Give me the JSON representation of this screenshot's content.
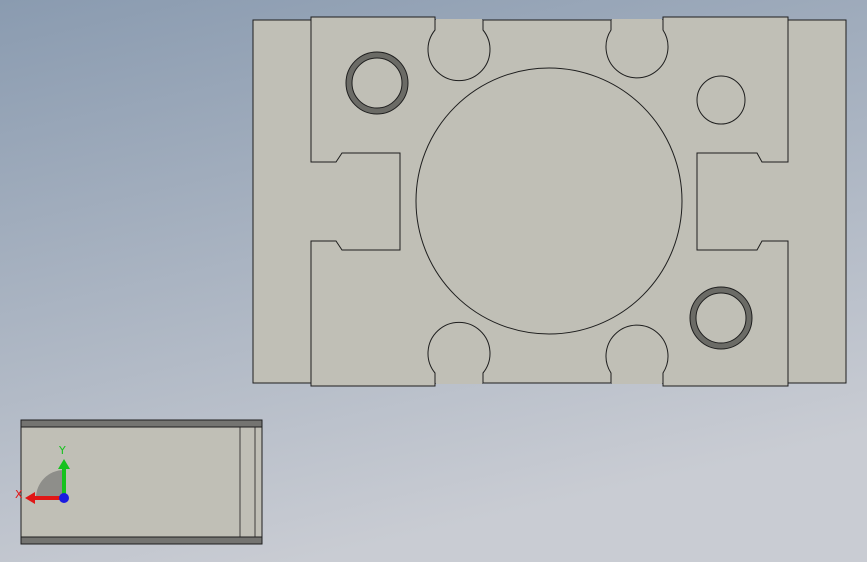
{
  "colors": {
    "background_top": "#8a9bb0",
    "background_bottom": "#c9ccd3",
    "part_face": "#c0bfb6",
    "part_edge": "#1e1e1e",
    "bore_ring": "#6b6b66",
    "side_band": "#747471",
    "axis_x": "#e01616",
    "axis_y": "#16c21e",
    "axis_z": "#1a1ae0",
    "triad_fan": "#8e8e8a"
  },
  "triad": {
    "x_label": "X",
    "y_label": "Y"
  }
}
